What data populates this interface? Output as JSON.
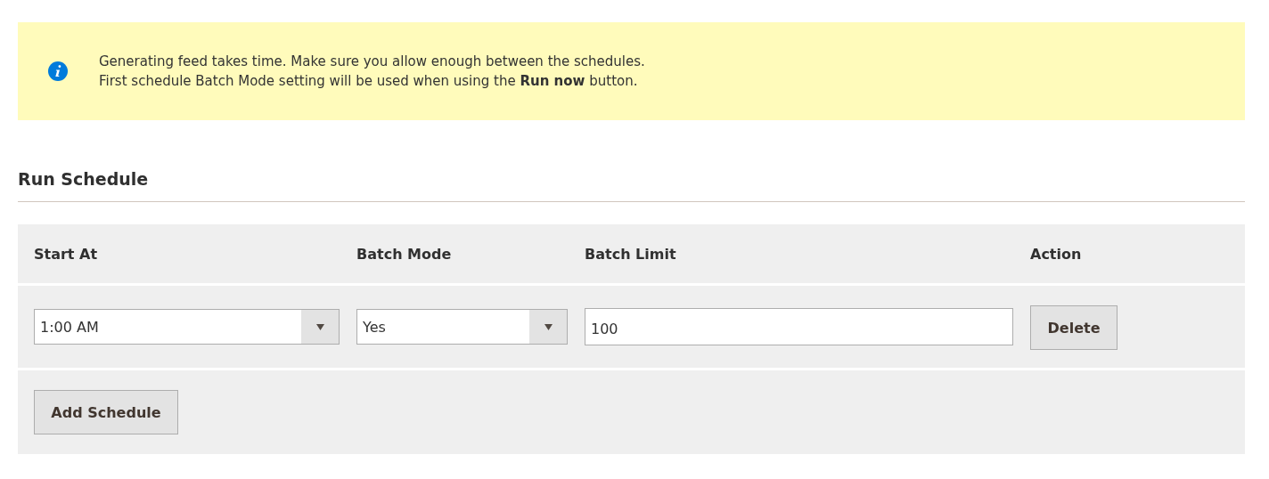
{
  "notice": {
    "lines": [
      "Generating feed takes time. Make sure you allow enough between the schedules.",
      "First schedule Batch Mode setting will be used when using the **Run now** button."
    ]
  },
  "section_title": "Run Schedule",
  "table": {
    "columns": [
      "Start At",
      "Batch Mode",
      "Batch Limit",
      "Action"
    ],
    "rows": [
      {
        "start_at": "1:00 AM",
        "batch_mode": "Yes",
        "batch_limit": "100",
        "action": "Delete"
      }
    ]
  },
  "add_button": "Add Schedule"
}
